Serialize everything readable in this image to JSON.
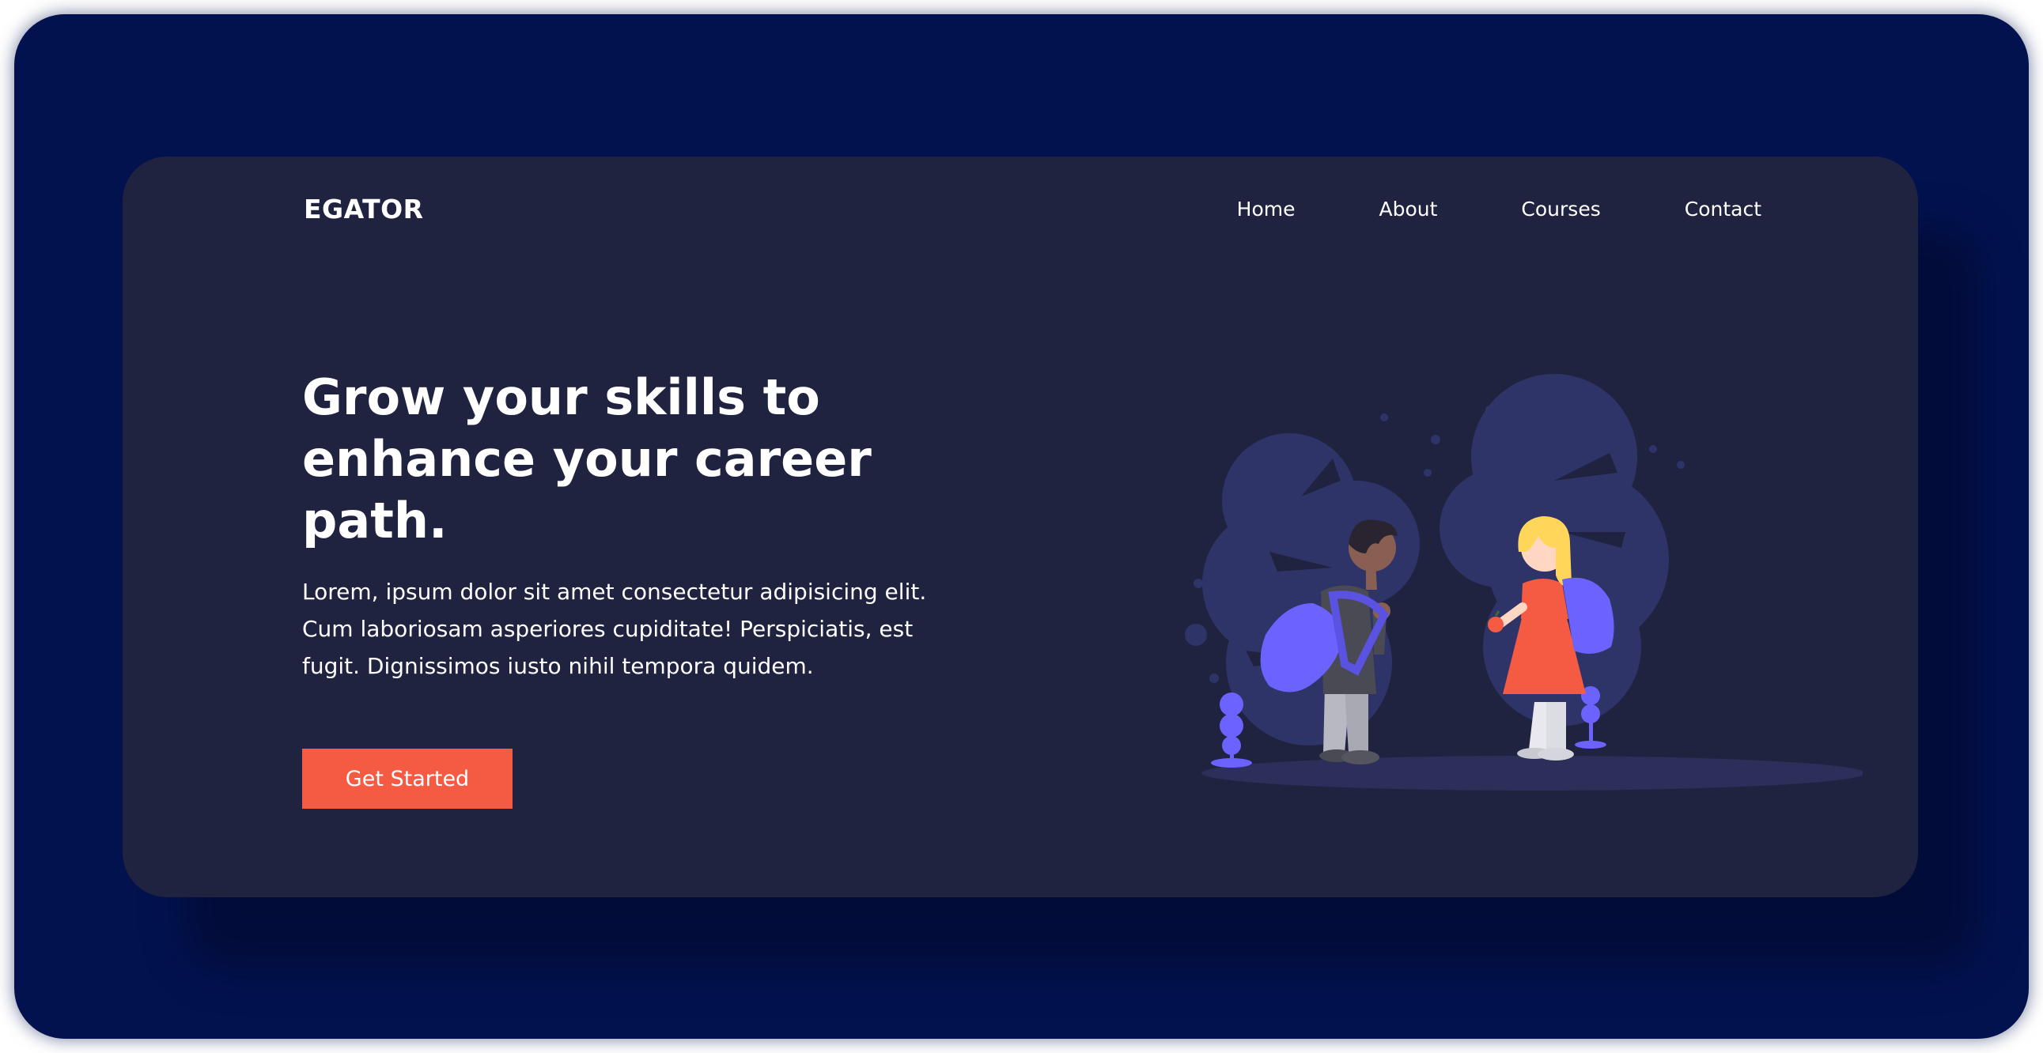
{
  "brand": {
    "logo": "EGATOR"
  },
  "nav": {
    "items": [
      {
        "label": "Home"
      },
      {
        "label": "About"
      },
      {
        "label": "Courses"
      },
      {
        "label": "Contact"
      }
    ]
  },
  "hero": {
    "headline": "Grow your skills to enhance your career path.",
    "body": "Lorem, ipsum dolor sit amet consectetur adipisicing elit. Cum laboriosam asperiores cupiditate! Perspiciatis, est fugit. Dignissimos iusto nihil tempora quidem.",
    "cta_label": "Get Started",
    "illustration_icon": "students-with-backpacks-illustration"
  },
  "colors": {
    "background": "#02124f",
    "card": "#1f2340",
    "accent": "#f55a43",
    "illustration_purple": "#6c63ff",
    "illustration_bush": "#2f3468"
  }
}
